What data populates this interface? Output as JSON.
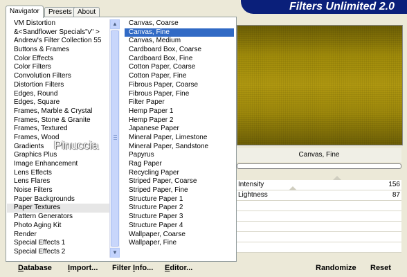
{
  "tabs": [
    {
      "label": "Navigator",
      "active": true
    },
    {
      "label": "Presets",
      "active": false
    },
    {
      "label": "About",
      "active": false
    }
  ],
  "banner": {
    "title": "Filters Unlimited 2.0"
  },
  "categories": [
    "VM Distortion",
    "&<Sandflower Specials\"v\" >",
    "Andrew's Filter Collection 55",
    "Buttons & Frames",
    "Color Effects",
    "Color Filters",
    "Convolution Filters",
    "Distortion Filters",
    "Edges, Round",
    "Edges, Square",
    "Frames, Marble & Crystal",
    "Frames, Stone & Granite",
    "Frames, Textured",
    "Frames, Wood",
    "Gradients",
    "Graphics Plus",
    "Image Enhancement",
    "Lens Effects",
    "Lens Flares",
    "Noise Filters",
    "Paper Backgrounds",
    "Paper Textures",
    "Pattern Generators",
    "Photo Aging Kit",
    "Render",
    "Special Effects 1",
    "Special Effects 2"
  ],
  "selected_category": "Paper Textures",
  "filters": [
    "Canvas, Coarse",
    "Canvas, Fine",
    "Canvas, Medium",
    "Cardboard Box, Coarse",
    "Cardboard Box, Fine",
    "Cotton Paper, Coarse",
    "Cotton Paper, Fine",
    "Fibrous Paper, Coarse",
    "Fibrous Paper, Fine",
    "Filter Paper",
    "Hemp Paper 1",
    "Hemp Paper 2",
    "Japanese Paper",
    "Mineral Paper, Limestone",
    "Mineral Paper, Sandstone",
    "Papyrus",
    "Rag Paper",
    "Recycling Paper",
    "Striped Paper, Coarse",
    "Striped Paper, Fine",
    "Structure Paper 1",
    "Structure Paper 2",
    "Structure Paper 3",
    "Structure Paper 4",
    "Wallpaper, Coarse",
    "Wallpaper, Fine"
  ],
  "selected_filter": "Canvas, Fine",
  "watermark": "Pinuccia",
  "preview": {
    "filter_name": "Canvas, Fine"
  },
  "params": [
    {
      "label": "Intensity",
      "value": "156",
      "level": 0.61
    },
    {
      "label": "Lightness",
      "value": "87",
      "level": 0.34
    }
  ],
  "buttons": {
    "database": {
      "key": "D",
      "rest": "atabase"
    },
    "import": {
      "key": "I",
      "rest": "mport..."
    },
    "filter_info": {
      "pre": "Filter ",
      "key": "I",
      "rest": "nfo..."
    },
    "editor": {
      "key": "E",
      "rest": "ditor..."
    },
    "randomize": "Randomize",
    "reset": "Reset"
  },
  "colors": {
    "banner": "#0a1f7a",
    "selection": "#316ac5",
    "preview_gold": "#a08b0a"
  }
}
